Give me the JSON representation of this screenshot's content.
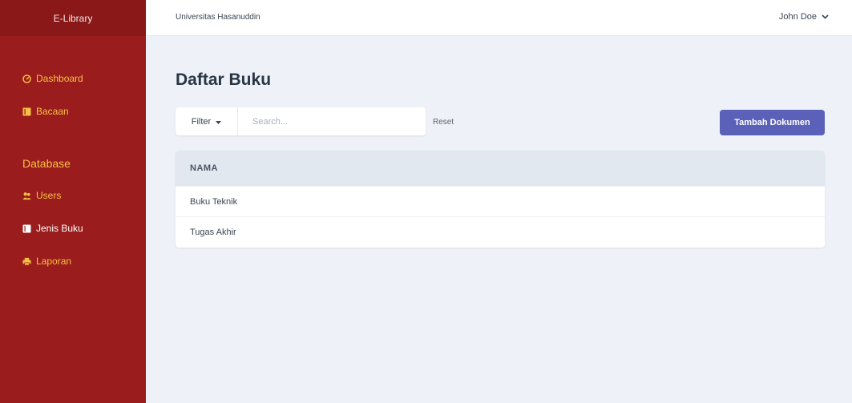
{
  "app": {
    "brand": "E-Library"
  },
  "sidebar": {
    "items": [
      {
        "label": "Dashboard",
        "icon": "dashboard-icon"
      },
      {
        "label": "Bacaan",
        "icon": "book-icon"
      }
    ],
    "section_heading": "Database",
    "db_items": [
      {
        "label": "Users",
        "icon": "users-icon"
      },
      {
        "label": "Jenis Buku",
        "icon": "book-icon"
      },
      {
        "label": "Laporan",
        "icon": "printer-icon"
      }
    ]
  },
  "topbar": {
    "organization": "Universitas Hasanuddin",
    "user_name": "John Doe",
    "user_icon": "chevron-down-icon"
  },
  "main": {
    "title": "Daftar Buku",
    "filter_label": "Filter",
    "search_placeholder": "Search...",
    "reset_label": "Reset",
    "add_button_label": "Tambah Dokumen",
    "table": {
      "columns": [
        "NAMA"
      ],
      "rows": [
        {
          "nama": "Buku Teknik"
        },
        {
          "nama": "Tugas Akhir"
        }
      ]
    }
  },
  "colors": {
    "sidebar": "#9b1c1c",
    "sidebar_brand": "#8a1818",
    "sidebar_text": "#f6c244",
    "accent_button": "#5b61b8",
    "background": "#eef1f7"
  }
}
